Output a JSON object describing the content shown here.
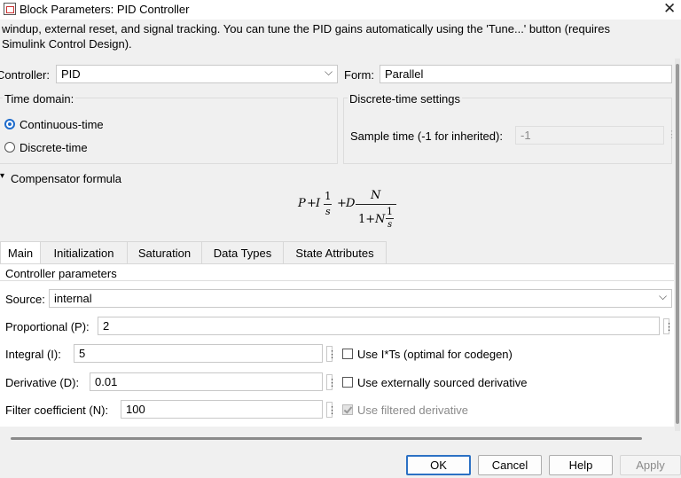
{
  "window": {
    "title": "Block Parameters: PID Controller"
  },
  "description": "windup, external reset, and signal tracking. You can tune the PID gains automatically using the 'Tune...' button (requires Simulink Control Design).",
  "controller": {
    "label": "Controller:",
    "value": "PID"
  },
  "form": {
    "label": "Form:",
    "value": "Parallel"
  },
  "time_domain": {
    "label": "Time domain:",
    "options": [
      {
        "label": "Continuous-time",
        "selected": true
      },
      {
        "label": "Discrete-time",
        "selected": false
      }
    ]
  },
  "discrete_settings": {
    "label": "Discrete-time settings",
    "sample_time_label": "Sample time (-1 for inherited):",
    "sample_time_value": "-1"
  },
  "compensator": {
    "label": "Compensator formula",
    "formula": {
      "p": "P",
      "i": "I",
      "d": "D",
      "n": "N",
      "one": "1",
      "s": "s",
      "plus": "+",
      "onep": "1+"
    }
  },
  "tabs": [
    "Main",
    "Initialization",
    "Saturation",
    "Data Types",
    "State Attributes"
  ],
  "main": {
    "section_label": "Controller parameters",
    "source_label": "Source:",
    "source_value": "internal",
    "proportional_label": "Proportional (P):",
    "proportional_value": "2",
    "integral_label": "Integral (I):",
    "integral_value": "5",
    "derivative_label": "Derivative (D):",
    "derivative_value": "0.01",
    "filter_label": "Filter coefficient (N):",
    "filter_value": "100",
    "use_its_label": "Use I*Ts (optimal for codegen)",
    "use_ext_deriv_label": "Use externally sourced derivative",
    "use_filtered_label": "Use filtered derivative"
  },
  "buttons": {
    "ok": "OK",
    "cancel": "Cancel",
    "help": "Help",
    "apply": "Apply"
  },
  "colors": {
    "accent": "#1f6ccc",
    "default_button_border": "#2c71c4"
  },
  "icons": {
    "close": "✕",
    "dropdown": "⌵",
    "more": "⋮",
    "collapse": "▾"
  }
}
